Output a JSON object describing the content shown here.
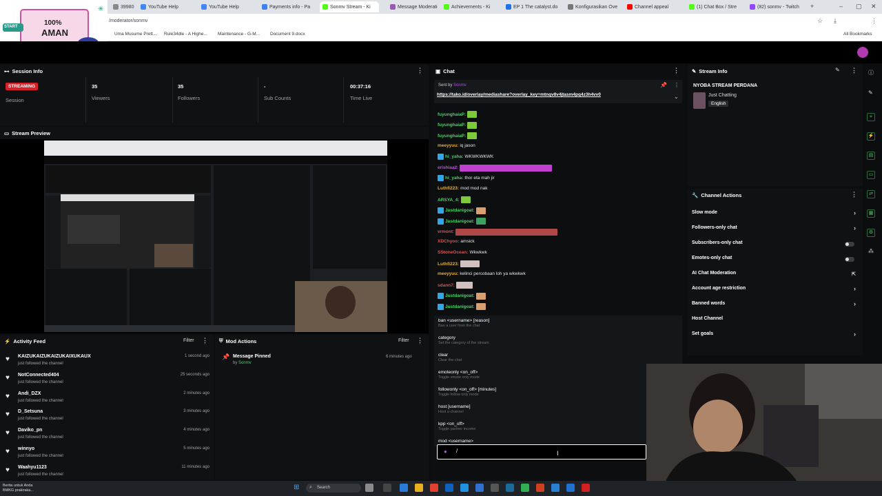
{
  "browser": {
    "tabs": [
      {
        "label": "39980",
        "color": "#888"
      },
      {
        "label": "YouTube Help",
        "color": "#4285f4"
      },
      {
        "label": "YouTube Help",
        "color": "#4285f4"
      },
      {
        "label": "Payments info - Pa",
        "color": "#3b82f6"
      },
      {
        "label": "Sonmv Stream - Ki",
        "color": "#53fc18",
        "active": true
      },
      {
        "label": "Message Moderati",
        "color": "#9b59b6"
      },
      {
        "label": "Achievements - Ki",
        "color": "#53fc18"
      },
      {
        "label": "EP 1 The catalyst.do",
        "color": "#1a73e8"
      },
      {
        "label": "Konfigurasikan Ove",
        "color": "#777"
      },
      {
        "label": "Channel appeal",
        "color": "#ff0000"
      },
      {
        "label": "(1) Chat Box / Stre",
        "color": "#53fc18"
      },
      {
        "label": "(82) sonmv - Twitch",
        "color": "#9146ff"
      }
    ],
    "url": "/moderator/sonmv",
    "bookmarks": [
      "Uma Musume Prett...",
      "Rule34dle - A Highe...",
      "Maintenance - G-M...",
      "Document 9.docx"
    ],
    "all_bookmarks": "All Bookmarks"
  },
  "logo": {
    "line1": "100%",
    "line2": "AMAN",
    "badge": "START"
  },
  "session": {
    "title": "Session Info",
    "status": "STREAMING",
    "status_label": "Session",
    "viewers": "35",
    "viewers_label": "Viewers",
    "followers": "35",
    "followers_label": "Followers",
    "subs": "-",
    "subs_label": "Sub Counts",
    "time": "00:37:16",
    "time_label": "Time Live"
  },
  "preview": {
    "title": "Stream Preview"
  },
  "activity": {
    "title": "Activity Feed",
    "filter": "Filter",
    "items": [
      {
        "name": "KAIZUKAIZUKAIZUKAIXUKAUX",
        "desc": "just followed the channel",
        "time": "1 second ago"
      },
      {
        "name": "NotConnected404",
        "desc": "just followed the channel",
        "time": "25 seconds ago"
      },
      {
        "name": "Andi_DZX",
        "desc": "just followed the channel",
        "time": "2 minutes ago"
      },
      {
        "name": "D_Setsuna",
        "desc": "just followed the channel",
        "time": "3 minutes ago"
      },
      {
        "name": "Daviko_pn",
        "desc": "just followed the channel",
        "time": "4 minutes ago"
      },
      {
        "name": "winnyo",
        "desc": "just followed the channel",
        "time": "5 minutes ago"
      },
      {
        "name": "Waahyu1123",
        "desc": "just followed the channel",
        "time": "11 minutes ago"
      }
    ]
  },
  "mod_actions": {
    "title": "Mod Actions",
    "filter": "Filter",
    "item": {
      "title": "Message Pinned",
      "by": "by",
      "user": "Sonmv",
      "time": "6 minutes ago"
    }
  },
  "chat": {
    "title": "Chat",
    "pinned_by": "Sent by",
    "pinned_user": "Sonmv",
    "pinned_link": "https://tako.id/overlay/mediashare?overlay_key=mtnqv8v4jtasm4pq4z3h4vv0",
    "messages": [
      {
        "user": "fuyunghaiaP:",
        "color": "#46d46a",
        "text": "",
        "emote": "#7ec83c",
        "badge": false
      },
      {
        "user": "fuyunghaiaP:",
        "color": "#46d46a",
        "text": "",
        "emote": "#7ec83c",
        "badge": false
      },
      {
        "user": "fuyunghaiaP:",
        "color": "#46d46a",
        "text": "",
        "emote": "#7ec83c",
        "badge": false
      },
      {
        "user": "meeyyuu:",
        "color": "#e0b040",
        "text": "iq jason",
        "emote": "",
        "badge": false
      },
      {
        "user": "hi_yaha:",
        "color": "#46d46a",
        "text": "WKWKWKWK",
        "emote": "",
        "badge": true
      },
      {
        "user": "erishiaa2:",
        "color": "#c050e0",
        "text": "",
        "emote": "#c040d0",
        "badge": false
      },
      {
        "user": "hi_yaha:",
        "color": "#46d46a",
        "text": "thor eta mah jir",
        "emote": "",
        "badge": true
      },
      {
        "user": "Luthfi223:",
        "color": "#e0b040",
        "text": "mod mod nak",
        "emote": "",
        "badge": false
      },
      {
        "user": "ARSYA_4:",
        "color": "#46d46a",
        "text": "",
        "emote": "#7ec83c",
        "badge": false
      },
      {
        "user": "Justdanigoat:",
        "color": "#46d46a",
        "text": "",
        "emote": "#d8a070",
        "badge": true
      },
      {
        "user": "Justdanigoat:",
        "color": "#46d46a",
        "text": "",
        "emote": "#3ca060",
        "badge": true
      },
      {
        "user": "vrmont:",
        "color": "#e05050",
        "text": "",
        "emote": "#b04848",
        "badge": false
      },
      {
        "user": "XDChyoo:",
        "color": "#e05050",
        "text": "amsick",
        "emote": "",
        "badge": false
      },
      {
        "user": "SStoneOcean:",
        "color": "#e05050",
        "text": "Wkwkwk",
        "emote": "",
        "badge": false
      },
      {
        "user": "Luthfi223:",
        "color": "#e0b040",
        "text": "",
        "emote": "#d0c0c0",
        "badge": false
      },
      {
        "user": "meeyyuu:",
        "color": "#e0b040",
        "text": "kelinci percobaan loh ya wkwkwk",
        "emote": "",
        "badge": false
      },
      {
        "user": "sdann7:",
        "color": "#e05050",
        "text": "",
        "emote": "#d0c0c0",
        "badge": false
      },
      {
        "user": "Justdanigoat:",
        "color": "#46d46a",
        "text": "",
        "emote": "#d8a070",
        "badge": true
      },
      {
        "user": "Justdanigoat:",
        "color": "#46d46a",
        "text": "",
        "emote": "#d8a070",
        "badge": true
      }
    ],
    "commands": [
      {
        "cmd": "ban <username> [reason]",
        "desc": "Ban a user from the chat"
      },
      {
        "cmd": "category",
        "desc": "Set the category of the stream"
      },
      {
        "cmd": "clear",
        "desc": "Clear the chat"
      },
      {
        "cmd": "emoteonly <on_off>",
        "desc": "Toggle emote only mode"
      },
      {
        "cmd": "followonly <on_off> [minutes]",
        "desc": "Toggle follow only mode"
      },
      {
        "cmd": "host [username]",
        "desc": "Host a channel"
      },
      {
        "cmd": "kpp <on_off>",
        "desc": "Toggle partner income"
      },
      {
        "cmd": "mod <username>",
        "desc": ""
      }
    ],
    "input_value": "/"
  },
  "stream_info": {
    "title": "Stream Info",
    "stream_title": "NYOBA STREAM PERDANA",
    "category": "Just Chatting",
    "tag": "English"
  },
  "channel_actions": {
    "title": "Channel Actions",
    "items": [
      {
        "label": "Slow mode",
        "control": "arrow"
      },
      {
        "label": "Followers-only chat",
        "control": "arrow"
      },
      {
        "label": "Subscribers-only chat",
        "control": "toggle"
      },
      {
        "label": "Emotes-only chat",
        "control": "toggle"
      },
      {
        "label": "AI Chat Moderation",
        "control": "external"
      },
      {
        "label": "Account age restriction",
        "control": "arrow"
      },
      {
        "label": "Banned words",
        "control": "arrow"
      },
      {
        "label": "Host Channel",
        "control": "none"
      },
      {
        "label": "Set goals",
        "control": "arrow"
      }
    ]
  },
  "taskbar": {
    "weather_title": "Berita untuk Anda",
    "weather_sub": "BMKG prakiraka...",
    "search": "Search"
  }
}
